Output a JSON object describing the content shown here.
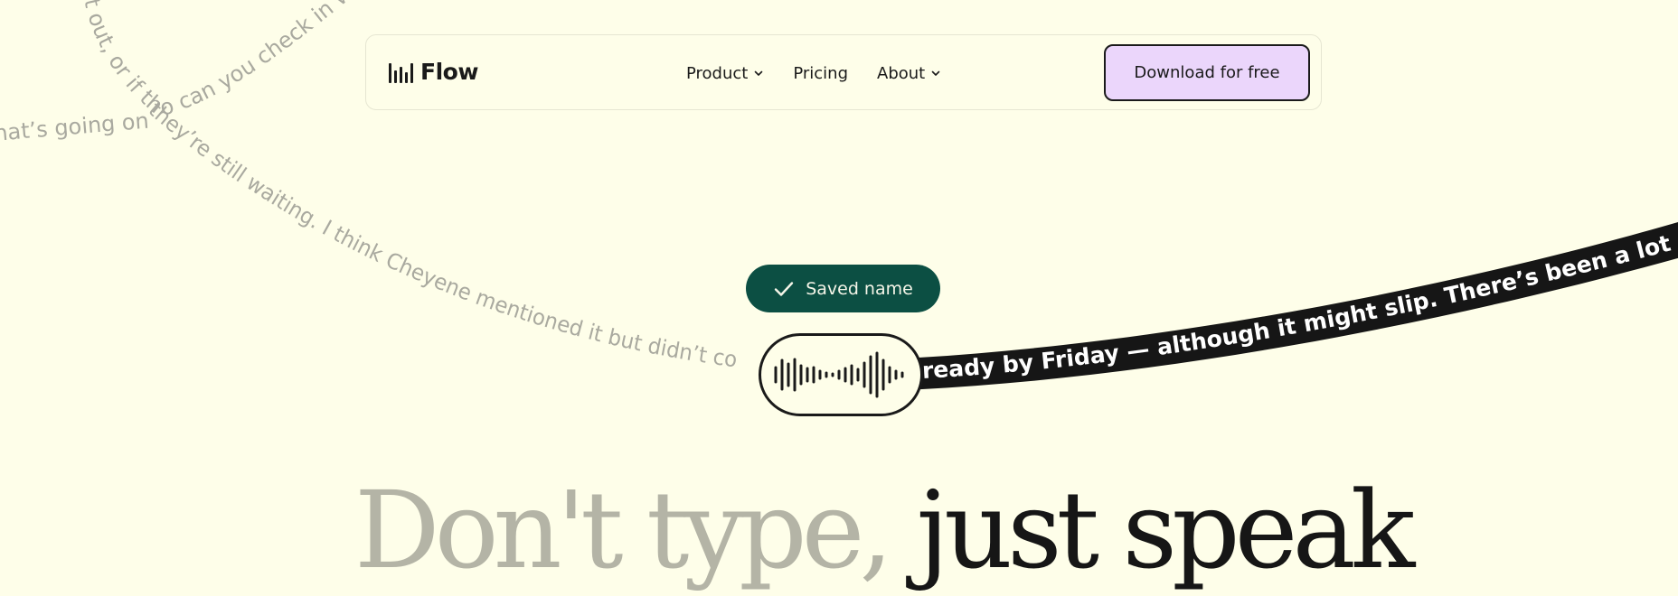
{
  "nav": {
    "brand": "Flow",
    "links": [
      {
        "label": "Product",
        "has_dropdown": true
      },
      {
        "label": "Pricing",
        "has_dropdown": false
      },
      {
        "label": "About",
        "has_dropdown": true
      }
    ],
    "cta_label": "Download for free"
  },
  "background_text": {
    "arc_1": "it out, or if the",
    "arc_1b": "o can you check in w",
    "line_2": "hat’s going on b",
    "line_3": "they’re still waiting. I think Cheyene mentioned it but didn’t co",
    "ribbon": "ready by Friday — although it might slip. There’s been a lot of back"
  },
  "status": {
    "saved_label": "Saved name",
    "icon": "check-icon"
  },
  "voice": {
    "icon": "waveform-icon"
  },
  "hero": {
    "headline_part1": "Don't type,",
    "headline_part2": " just speak"
  },
  "colors": {
    "background": "#fefee9",
    "cta_bg": "#ebd6fb",
    "saved_bg": "#0c4f43",
    "ribbon_bg": "#161616",
    "muted_text": "#a9a99f"
  }
}
